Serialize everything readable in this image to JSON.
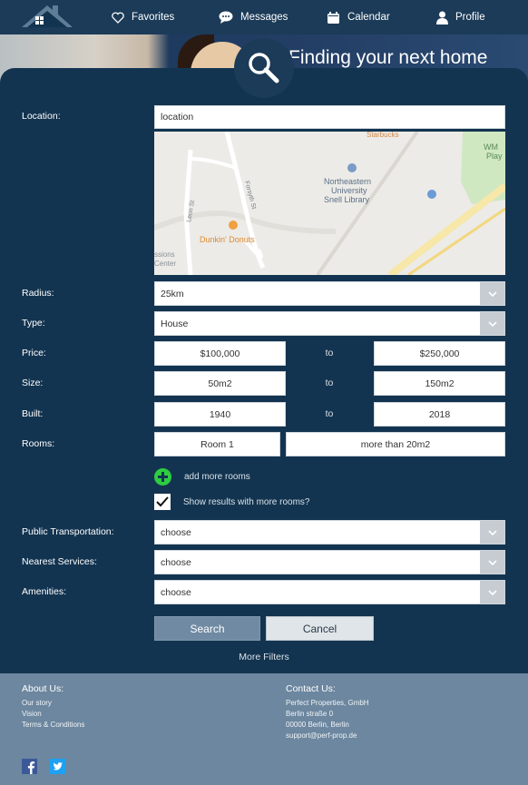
{
  "nav": {
    "items": [
      {
        "label": "Favorites",
        "icon": "heart-icon"
      },
      {
        "label": "Messages",
        "icon": "chat-bubble-icon"
      },
      {
        "label": "Calendar",
        "icon": "calendar-icon"
      },
      {
        "label": "Profile",
        "icon": "user-icon"
      }
    ]
  },
  "hero": {
    "title": "Finding your next home"
  },
  "form": {
    "location": {
      "label": "Location:",
      "value": "location"
    },
    "map": {
      "labels": {
        "starbucks": "Starbucks",
        "library_1": "Northeastern",
        "library_2": "University",
        "library_3": "Snell Library",
        "donuts": "Dunkin' Donuts",
        "wm_1": "WM",
        "wm_2": "Play",
        "leon": "Leon St",
        "forsyth": "Forsyth St",
        "missions_1": "ssions",
        "missions_2": "Center"
      }
    },
    "radius": {
      "label": "Radius:",
      "value": "25km"
    },
    "type": {
      "label": "Type:",
      "value": "House"
    },
    "price": {
      "label": "Price:",
      "from": "$100,000",
      "sep": "to",
      "to": "$250,000"
    },
    "size": {
      "label": "Size:",
      "from": "50m2",
      "sep": "to",
      "to": "150m2"
    },
    "built": {
      "label": "Built:",
      "from": "1940",
      "sep": "to",
      "to": "2018"
    },
    "rooms": {
      "label": "Rooms:",
      "room": "Room 1",
      "size": "more than 20m2"
    },
    "add_rooms": "add more rooms",
    "show_more": {
      "label": "Show results with more rooms?",
      "checked": true
    },
    "public_transport": {
      "label": "Public Transportation:",
      "value": "choose"
    },
    "nearest_services": {
      "label": "Nearest Services:",
      "value": "choose"
    },
    "amenities": {
      "label": "Amenities:",
      "value": "choose"
    },
    "search_label": "Search",
    "cancel_label": "Cancel",
    "more_filters": "More Filters"
  },
  "footer": {
    "about": {
      "heading": "About Us:",
      "links": [
        "Our story",
        "Vision",
        "Terms & Conditions"
      ]
    },
    "contact": {
      "heading": "Contact Us:",
      "lines": [
        "Perfect Properties, GmbH",
        "Berlin straße 0",
        "00000 Berlin, Berlin",
        "support@perf-prop.de"
      ]
    }
  },
  "colors": {
    "navy": "#133450",
    "footer": "#6c879f",
    "accent_green": "#2ecc40"
  }
}
